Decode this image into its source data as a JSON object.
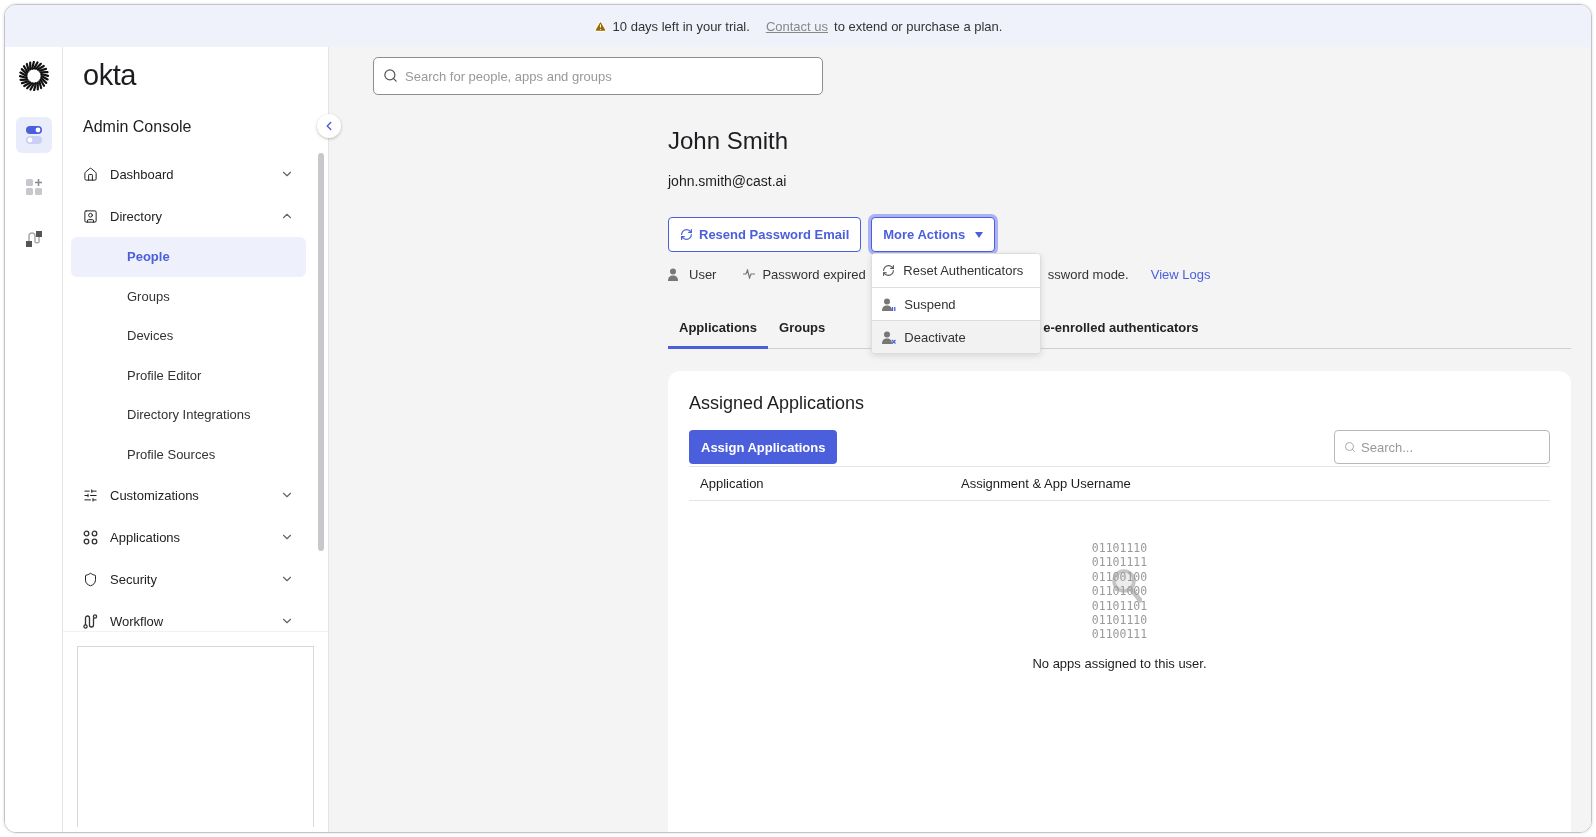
{
  "banner": {
    "message": "10 days left in your trial.",
    "link": "Contact us",
    "suffix": "to extend or purchase a plan."
  },
  "brand": {
    "logo": "okta",
    "title": "Admin Console"
  },
  "rail": [
    {
      "kind": "toggle",
      "selected": true
    },
    {
      "kind": "apps",
      "selected": false
    },
    {
      "kind": "workflow",
      "selected": false
    }
  ],
  "nav": [
    {
      "label": "Dashboard",
      "kind": "home",
      "expanded": false
    },
    {
      "label": "Directory",
      "kind": "directory",
      "expanded": true,
      "children": [
        {
          "label": "People",
          "selected": true
        },
        {
          "label": "Groups",
          "selected": false
        },
        {
          "label": "Devices",
          "selected": false
        },
        {
          "label": "Profile Editor",
          "selected": false
        },
        {
          "label": "Directory Integrations",
          "selected": false
        },
        {
          "label": "Profile Sources",
          "selected": false
        }
      ]
    },
    {
      "label": "Customizations",
      "kind": "sliders",
      "expanded": false
    },
    {
      "label": "Applications",
      "kind": "apps",
      "expanded": false
    },
    {
      "label": "Security",
      "kind": "shield",
      "expanded": false
    },
    {
      "label": "Workflow",
      "kind": "workflow",
      "expanded": false
    }
  ],
  "search": {
    "placeholder": "Search for people, apps and groups"
  },
  "user": {
    "name": "John Smith",
    "email": "john.smith@cast.ai"
  },
  "actions": [
    {
      "label": "Resend Password Email",
      "kind": "resend"
    },
    {
      "label": "More Actions",
      "kind": "menu",
      "expanded": true
    }
  ],
  "menu": [
    {
      "label": "Reset Authenticators",
      "kind": "reset",
      "highlighted": false
    },
    {
      "label": "Suspend",
      "kind": "suspend",
      "highlighted": false
    },
    {
      "label": "Deactivate",
      "kind": "deactivate",
      "highlighted": true
    }
  ],
  "status": [
    {
      "label": "User",
      "kind": "user"
    },
    {
      "label": "Password expired",
      "kind": "pulse"
    },
    {
      "label": "ssword mode.",
      "kind": "text"
    },
    {
      "label": "View Logs",
      "kind": "link"
    }
  ],
  "tabs": [
    {
      "label": "Applications",
      "selected": true
    },
    {
      "label": "Groups",
      "selected": false
    },
    {
      "label": "e-enrolled authenticators",
      "selected": false
    }
  ],
  "panel": {
    "title": "Assigned Applications",
    "button": "Assign Applications",
    "search_placeholder": "Search...",
    "columns": [
      "Application",
      "Assignment & App Username"
    ],
    "binary": [
      "01101110",
      "01101111",
      "01100100",
      "01101000",
      "01101101",
      "01101110",
      "01100111"
    ],
    "message": "No apps assigned to this user."
  }
}
